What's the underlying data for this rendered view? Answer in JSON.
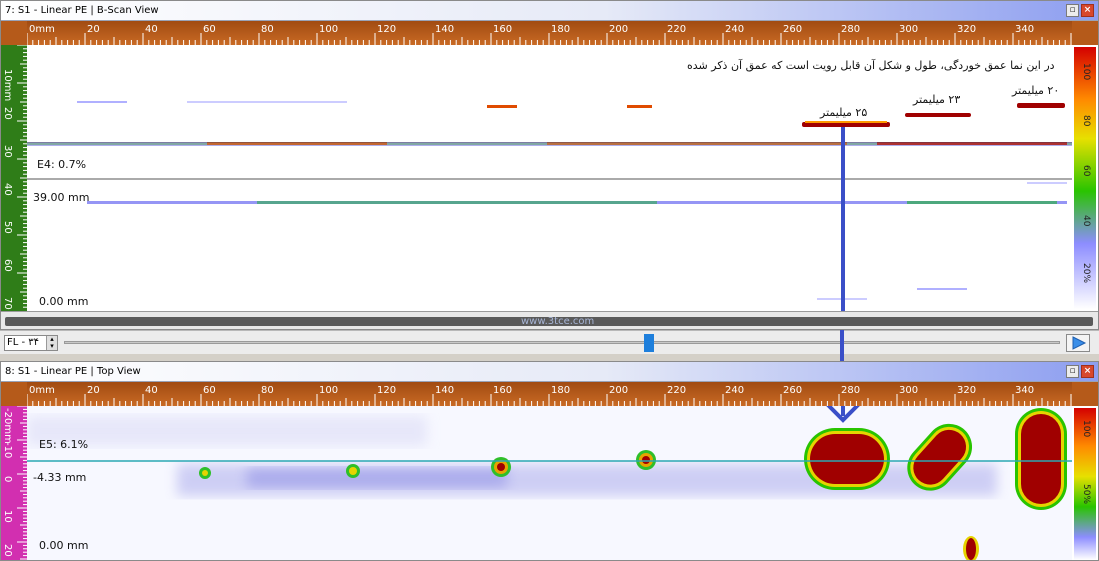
{
  "bscan": {
    "title": "7: S1 - Linear PE | B-Scan View",
    "max_icon": "maximize-icon",
    "close_icon": "close-icon",
    "x_ticks": [
      "0mm",
      "20",
      "40",
      "60",
      "80",
      "100",
      "120",
      "140",
      "160",
      "180",
      "200",
      "220",
      "240",
      "260",
      "280",
      "300",
      "320",
      "340"
    ],
    "y_ticks": [
      "10mm",
      "20",
      "30",
      "40",
      "50",
      "60",
      "70"
    ],
    "right_ticks": [
      "100",
      "80",
      "60",
      "40",
      "20%"
    ],
    "gate_label": "E4: 0.7%",
    "cursor_label": "39.00 mm",
    "zero_label": "0.00 mm",
    "annotation": "در این نما عمق خوردگی، طول و شکل آن قابل رویت است که عمق آن ذکر شده",
    "label_20": "۲۰ میلیمتر",
    "label_23": "۲۳ میلیمتر",
    "label_25": "۲۵ میلیمتر",
    "watermark": "www.3tce.com"
  },
  "controls": {
    "frame_select": "FL - ۳۴",
    "spinner_icon": "spinner-icon",
    "play_icon": "play-icon"
  },
  "topview": {
    "title": "8: S1 - Linear PE | Top View",
    "max_icon": "maximize-icon",
    "close_icon": "close-icon",
    "x_ticks": [
      "0mm",
      "20",
      "40",
      "60",
      "80",
      "100",
      "120",
      "140",
      "160",
      "180",
      "200",
      "220",
      "240",
      "260",
      "280",
      "300",
      "320",
      "340"
    ],
    "y_ticks": [
      "-20mm",
      "-10",
      "0",
      "10",
      "20"
    ],
    "right_ticks": [
      "100",
      "50%"
    ],
    "gate_label": "E5: 6.1%",
    "cursor_label": "-4.33 mm",
    "zero_label": "0.00 mm"
  },
  "colors": {
    "ruler_orange": "#c0601c",
    "ruler_green": "#2f7d18",
    "ruler_magenta": "#d22fb0",
    "defect_red": "#a00000",
    "arrow_blue": "#3a4fc8",
    "cursor_teal": "#2aa7b3"
  }
}
